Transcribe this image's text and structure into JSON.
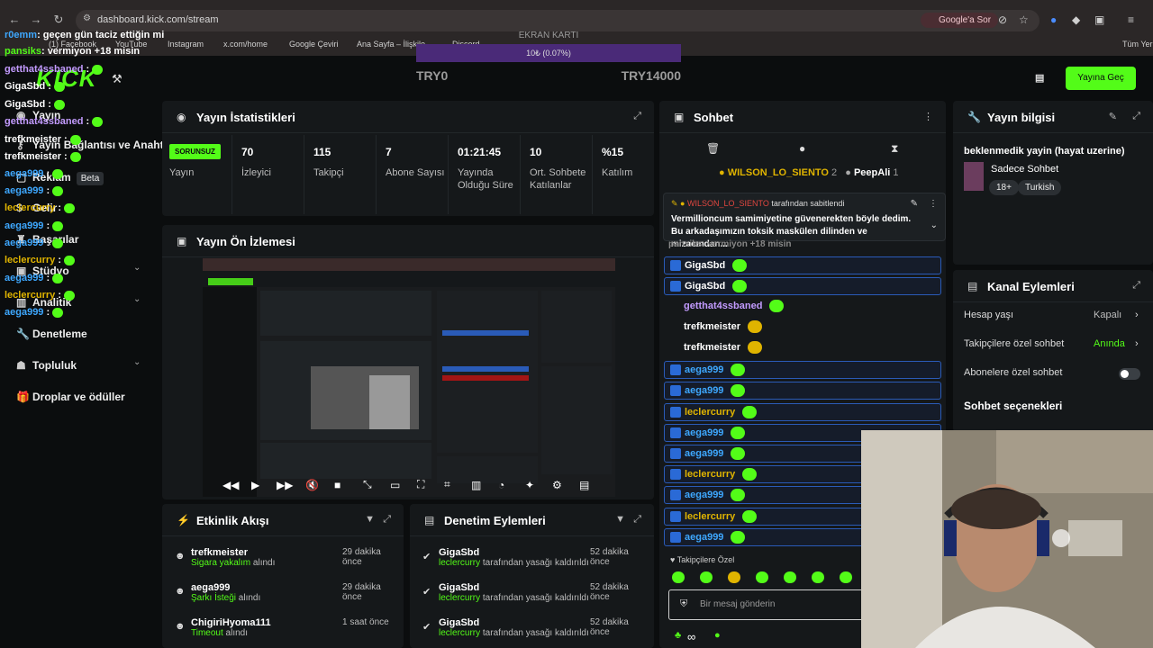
{
  "browser": {
    "url": "dashboard.kick.com/stream",
    "bookmarks": [
      "(1) Facebook",
      "YouTube",
      "Instagram",
      "x.com/home",
      "Google Çeviri",
      "Ana Sayfa – İlişkile...",
      "Discord"
    ],
    "all_bookmarks": "Tüm Yer",
    "google_ask": "Google'a Sor"
  },
  "overlay_chat": [
    {
      "name": "r0emm",
      "msg": ": geçen gün taciz ettiğin mi",
      "color": "#3ea8ff"
    },
    {
      "name": "pansiks",
      "msg": ": vermiyon +18 misin",
      "color": "#53fc18"
    },
    {
      "name": "getthat4ssbaned",
      "msg": " :",
      "color": "#c39bff"
    },
    {
      "name": "GigaSbd",
      "msg": " :",
      "color": "#ffffff"
    },
    {
      "name": "GigaSbd",
      "msg": " :",
      "color": "#ffffff"
    },
    {
      "name": "getthat4ssbaned",
      "msg": " :",
      "color": "#c39bff"
    },
    {
      "name": "trefkmeister",
      "msg": " :",
      "color": "#ffffff"
    },
    {
      "name": "trefkmeister",
      "msg": " :",
      "color": "#ffffff"
    },
    {
      "name": "aega999",
      "msg": " :",
      "color": "#3ea8ff"
    },
    {
      "name": "aega999",
      "msg": " :",
      "color": "#3ea8ff"
    },
    {
      "name": "leclercurry",
      "msg": " :",
      "color": "#e0b400"
    },
    {
      "name": "aega999",
      "msg": " :",
      "color": "#3ea8ff"
    },
    {
      "name": "aega999",
      "msg": " :",
      "color": "#3ea8ff"
    },
    {
      "name": "leclercurry",
      "msg": " :",
      "color": "#e0b400"
    },
    {
      "name": "aega999",
      "msg": " :",
      "color": "#3ea8ff"
    },
    {
      "name": "leclercurry",
      "msg": " :",
      "color": "#e0b400"
    },
    {
      "name": "aega999",
      "msg": " :",
      "color": "#3ea8ff"
    }
  ],
  "gpu": {
    "title": "EKRAN KARTI",
    "progress_label": "10₺ (0.07%)",
    "progress_fraction": 0.0007,
    "min": "TRY0",
    "max": "TRY14000"
  },
  "header": {
    "go_live": "Yayına Geç"
  },
  "sidebar": {
    "items": [
      {
        "label": "Yayın",
        "icon": "broadcast-icon"
      },
      {
        "label": "Yayın Bağlantısı ve Anahtar",
        "icon": "key-icon"
      },
      {
        "label": "Reklam",
        "icon": "ad-icon",
        "badge": "Beta"
      },
      {
        "label": "Gelir",
        "icon": "money-icon"
      },
      {
        "label": "Başarılar",
        "icon": "trophy-icon"
      },
      {
        "label": "Stüdyo",
        "icon": "studio-icon"
      },
      {
        "label": "Analitik",
        "icon": "chart-icon"
      },
      {
        "label": "Denetleme",
        "icon": "wrench-icon"
      },
      {
        "label": "Topluluk",
        "icon": "community-icon"
      },
      {
        "label": "Droplar ve ödüller",
        "icon": "gift-icon"
      }
    ]
  },
  "stats": {
    "title": "Yayın İstatistikleri",
    "status_badge": "SORUNSUZ",
    "status_label": "Yayın",
    "items": [
      {
        "value": "70",
        "label": "İzleyici"
      },
      {
        "value": "115",
        "label": "Takipçi"
      },
      {
        "value": "7",
        "label": "Abone Sayısı"
      },
      {
        "value": "01:21:45",
        "label": "Yayında Olduğu Süre"
      },
      {
        "value": "10",
        "label": "Ort. Sohbete Katılanlar"
      },
      {
        "value": "%15",
        "label": "Katılım"
      }
    ]
  },
  "preview": {
    "title": "Yayın Ön İzlemesi"
  },
  "activity": {
    "title": "Etkinlik Akışı",
    "items": [
      {
        "user": "trefkmeister",
        "action": "Sigara yakalım",
        "suffix": " alındı",
        "time": "29 dakika önce"
      },
      {
        "user": "aega999",
        "action": "Şarkı İsteği",
        "suffix": " alındı",
        "time": "29 dakika önce"
      },
      {
        "user": "ChigiriHyoma111",
        "action": "Timeout",
        "suffix": " alındı",
        "time": "1 saat önce"
      }
    ]
  },
  "moderation": {
    "title": "Denetim Eylemleri",
    "items": [
      {
        "user": "GigaSbd",
        "target": "leclercurry",
        "text": " tarafından yasağı kaldırıldı",
        "time": "52 dakika önce"
      },
      {
        "user": "GigaSbd",
        "target": "leclercurry",
        "text": " tarafından yasağı kaldırıldı",
        "time": "52 dakika önce"
      },
      {
        "user": "GigaSbd",
        "target": "leclercurry",
        "text": " tarafından yasağı kaldırıldı",
        "time": "52 dakika önce"
      }
    ]
  },
  "chat": {
    "title": "Sohbet",
    "top_gifter": "WILSON_LO_SIENTO",
    "top_gifter_count": "2",
    "second_gifter": "PeepAli",
    "second_gifter_count": "1",
    "pinned_by": "WILSON_LO_SIENTO",
    "pinned_suffix": " tarafından sabitlendi",
    "pinned_text": "Vermillioncum samimiyetine güvenerekten böyle dedim. Bu arkadaşımızın toksik maskülen dilinden ve mizacından...",
    "faded_line": "pansiks: vermiyon +18 misin",
    "messages": [
      {
        "name": "GigaSbd",
        "color": "#ffffff",
        "boxed": true
      },
      {
        "name": "GigaSbd",
        "color": "#ffffff",
        "boxed": true
      },
      {
        "name": "getthat4ssbaned",
        "color": "#c39bff",
        "boxed": false
      },
      {
        "name": "trefkmeister",
        "color": "#ffffff",
        "boxed": false
      },
      {
        "name": "trefkmeister",
        "color": "#ffffff",
        "boxed": false
      },
      {
        "name": "aega999",
        "color": "#3ea8ff",
        "boxed": true
      },
      {
        "name": "aega999",
        "color": "#3ea8ff",
        "boxed": true
      },
      {
        "name": "leclercurry",
        "color": "#e0b400",
        "boxed": true
      },
      {
        "name": "aega999",
        "color": "#3ea8ff",
        "boxed": true
      },
      {
        "name": "aega999",
        "color": "#3ea8ff",
        "boxed": true
      },
      {
        "name": "leclercurry",
        "color": "#e0b400",
        "boxed": true
      },
      {
        "name": "aega999",
        "color": "#3ea8ff",
        "boxed": true
      },
      {
        "name": "leclercurry",
        "color": "#e0b400",
        "boxed": true
      },
      {
        "name": "aega999",
        "color": "#3ea8ff",
        "boxed": true
      }
    ],
    "followers_only": "Takipçilere Özel",
    "input_placeholder": "Bir mesaj gönderin",
    "footer_count": "∞"
  },
  "stream_info": {
    "title": "Yayın bilgisi",
    "stream_title": "beklenmedik yayin (hayat uzerine)",
    "category": "Sadece Sohbet",
    "tags": [
      "18+",
      "Turkish"
    ]
  },
  "channel_actions": {
    "title": "Kanal Eylemleri",
    "rows": [
      {
        "label": "Hesap yaşı",
        "value": "Kapalı",
        "value_color": "#bdbdbd"
      },
      {
        "label": "Takipçilere özel sohbet",
        "value": "Anında",
        "value_color": "#53fc18"
      },
      {
        "label": "Abonelere özel sohbet",
        "value": "",
        "value_color": ""
      }
    ],
    "section": "Sohbet seçenekleri"
  },
  "colors": {
    "accent": "#53fc18",
    "panel": "#15181a",
    "background": "#0b0d0e"
  }
}
